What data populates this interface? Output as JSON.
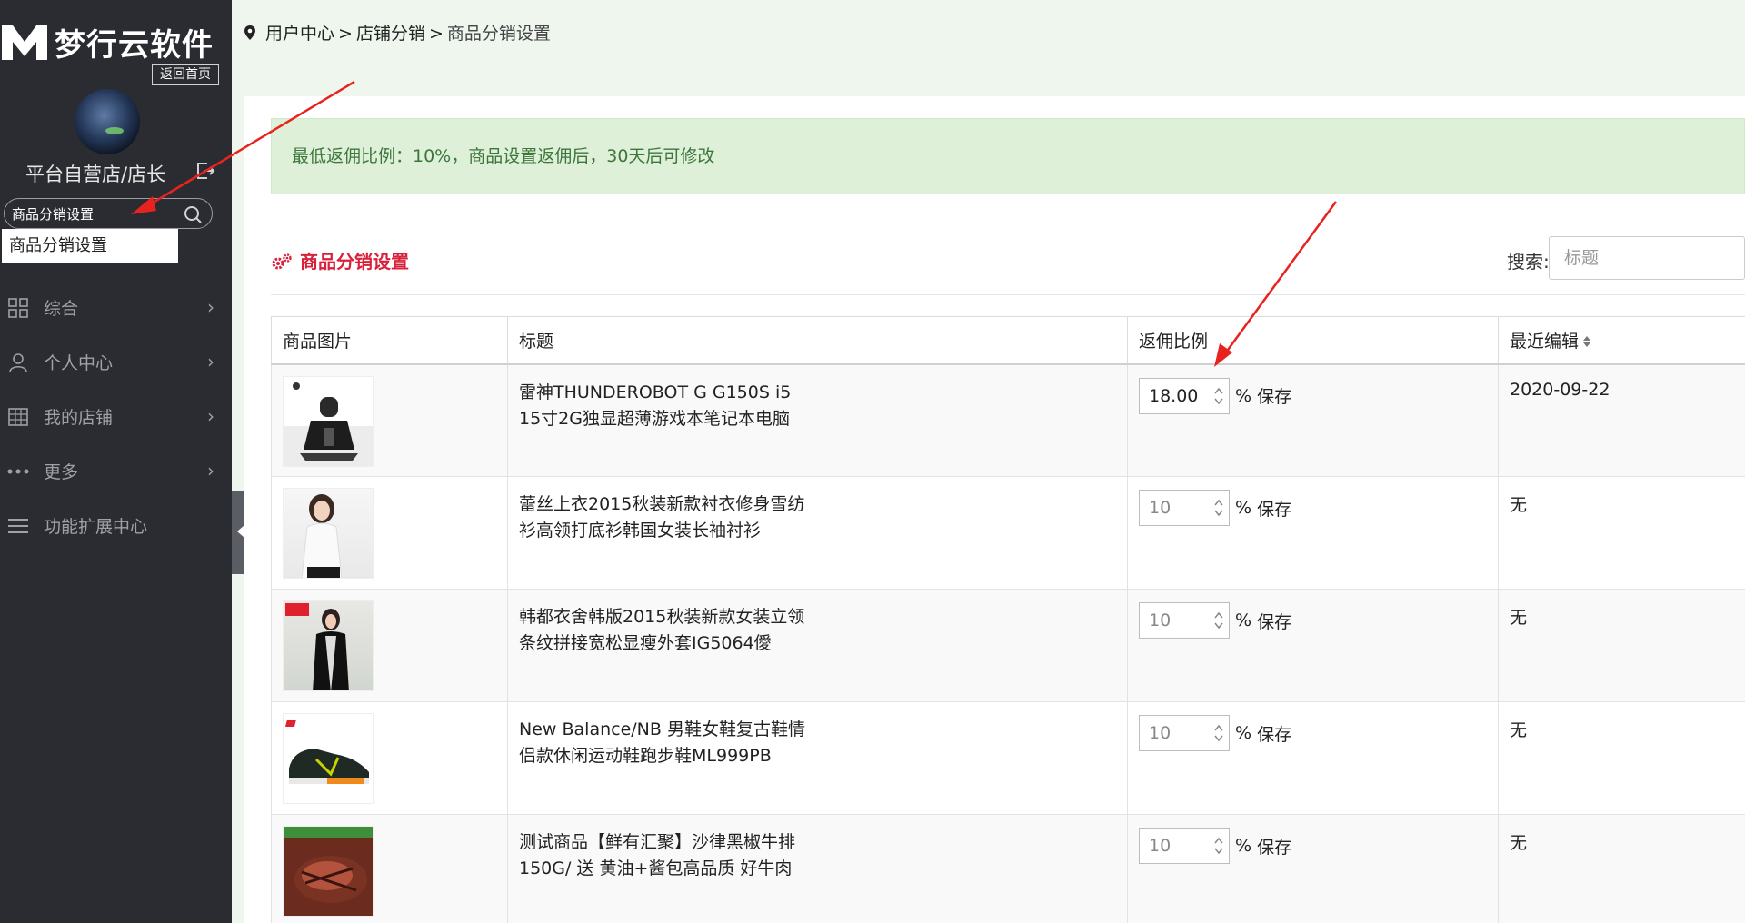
{
  "brand": {
    "name": "梦行云软件",
    "home_label": "返回首页"
  },
  "sidebar": {
    "shop_name": "平台自营店/店长",
    "search": {
      "value": "商品分销设置",
      "placeholder": ""
    },
    "suggestion": "商品分销设置",
    "items": [
      {
        "label": "综合",
        "icon": "grid-icon"
      },
      {
        "label": "个人中心",
        "icon": "user-icon"
      },
      {
        "label": "我的店铺",
        "icon": "store-icon"
      },
      {
        "label": "更多",
        "icon": "more-icon"
      },
      {
        "label": "功能扩展中心",
        "icon": "menu-icon"
      }
    ]
  },
  "breadcrumb": {
    "items": [
      "用户中心",
      "店铺分销",
      "商品分销设置"
    ],
    "separator": ">"
  },
  "notice": "最低返佣比例：10%，商品设置返佣后，30天后可修改",
  "section_title": "商品分销设置",
  "search": {
    "label": "搜索:",
    "placeholder": "标题"
  },
  "table": {
    "headers": [
      "商品图片",
      "标题",
      "返佣比例",
      "最近编辑"
    ],
    "suffix": "%",
    "save_label": "保存",
    "rows": [
      {
        "title": "雷神THUNDEROBOT G G150S i5 15寸2G独显超薄游戏本笔记本电脑",
        "rate": "18.00",
        "date": "2020-09-22"
      },
      {
        "title": "蕾丝上衣2015秋装新款衬衣修身雪纺衫高领打底衫韩国女装长袖衬衫",
        "rate": "10",
        "date": "无"
      },
      {
        "title": "韩都衣舍韩版2015秋装新款女装立领条纹拼接宽松显瘦外套IG5064僾",
        "rate": "10",
        "date": "无"
      },
      {
        "title": "New Balance/NB 男鞋女鞋复古鞋情侣款休闲运动鞋跑步鞋ML999PB",
        "rate": "10",
        "date": "无"
      },
      {
        "title": "测试商品【鲜有汇聚】沙律黑椒牛排150G/ 送 黄油+酱包高品质 好牛肉",
        "rate": "10",
        "date": "无"
      }
    ]
  },
  "colors": {
    "sidebar": "#2a2c31",
    "accent": "#d9213c",
    "notice_bg": "#dff0d8",
    "notice_text": "#3c763d",
    "annotation": "#e8231f"
  }
}
